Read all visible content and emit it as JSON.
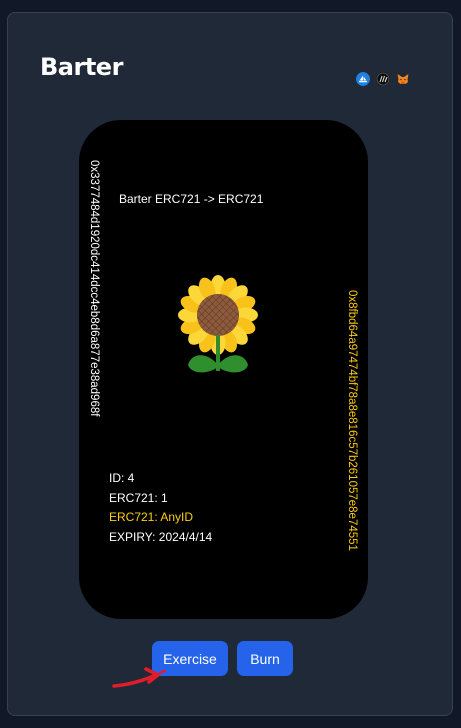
{
  "app": {
    "title": "Barter"
  },
  "header_icons": [
    {
      "name": "opensea-icon",
      "color": "#2081e2"
    },
    {
      "name": "blur-icon",
      "color": "#0b0b0b"
    },
    {
      "name": "metamask-icon",
      "color": "#f6851b"
    }
  ],
  "card": {
    "title": "Barter ERC721 -> ERC721",
    "address_left": "0x3377484d1920dc414dcc4eb8d6a877e38ad968f",
    "address_right": "0x8fbd64a97474bf78a8e816c57b261057e8e74551",
    "image_icon": "sunflower-icon",
    "info": {
      "id": "ID: 4",
      "erc721_give": "ERC721: 1",
      "erc721_want": "ERC721: AnyID",
      "expiry": "EXPIRY: 2024/4/14"
    }
  },
  "actions": {
    "exercise_label": "Exercise",
    "burn_label": "Burn"
  },
  "colors": {
    "accent": "#2563eb",
    "highlight": "#facc15",
    "annotation": "#e11d2b"
  }
}
